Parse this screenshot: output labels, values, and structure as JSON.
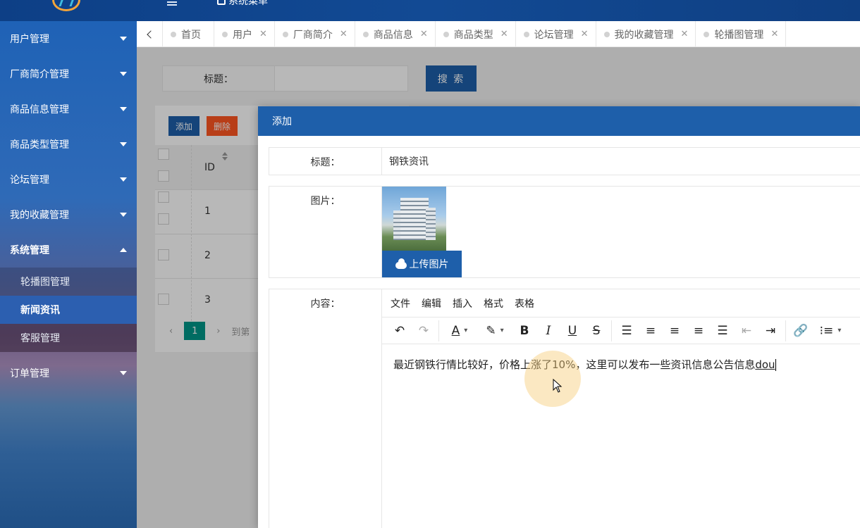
{
  "header": {
    "title": "系统菜单",
    "colors": {
      "primary": "#1e5faa",
      "danger": "#ff5722",
      "pager": "#009688"
    }
  },
  "sidebar": {
    "items": [
      {
        "label": "用户管理",
        "state": "collapsed"
      },
      {
        "label": "厂商简介管理",
        "state": "collapsed"
      },
      {
        "label": "商品信息管理",
        "state": "collapsed"
      },
      {
        "label": "商品类型管理",
        "state": "collapsed"
      },
      {
        "label": "论坛管理",
        "state": "collapsed"
      },
      {
        "label": "我的收藏管理",
        "state": "collapsed"
      },
      {
        "label": "系统管理",
        "state": "expanded"
      }
    ],
    "sub_items": [
      {
        "label": "轮播图管理"
      },
      {
        "label": "新闻资讯",
        "active": true
      },
      {
        "label": "客服管理"
      }
    ],
    "after": [
      {
        "label": "订单管理",
        "state": "collapsed"
      }
    ]
  },
  "tabs": [
    {
      "label": "首页",
      "closable": false
    },
    {
      "label": "用户",
      "closable": true
    },
    {
      "label": "厂商简介",
      "closable": true
    },
    {
      "label": "商品信息",
      "closable": true
    },
    {
      "label": "商品类型",
      "closable": true
    },
    {
      "label": "论坛管理",
      "closable": true
    },
    {
      "label": "我的收藏管理",
      "closable": true
    },
    {
      "label": "轮播图管理",
      "closable": true
    }
  ],
  "search": {
    "label": "标题：",
    "button": "搜 索"
  },
  "table": {
    "add_label": "添加",
    "delete_label": "删除",
    "column_id": "ID",
    "rows": [
      "1",
      "2",
      "3"
    ],
    "pager_current": "1",
    "pager_goto": "到第"
  },
  "modal": {
    "title": "添加",
    "fields": {
      "title_label": "标题：",
      "title_value": "钢铁资讯",
      "image_label": "图片：",
      "upload_label": "上传图片",
      "content_label": "内容："
    },
    "editor": {
      "menu": [
        "文件",
        "编辑",
        "插入",
        "格式",
        "表格"
      ],
      "content_main": "最近钢铁行情比较好，价格上涨了10%，这里可以发布一些资讯信息公告信息",
      "content_ime": "dou"
    }
  }
}
